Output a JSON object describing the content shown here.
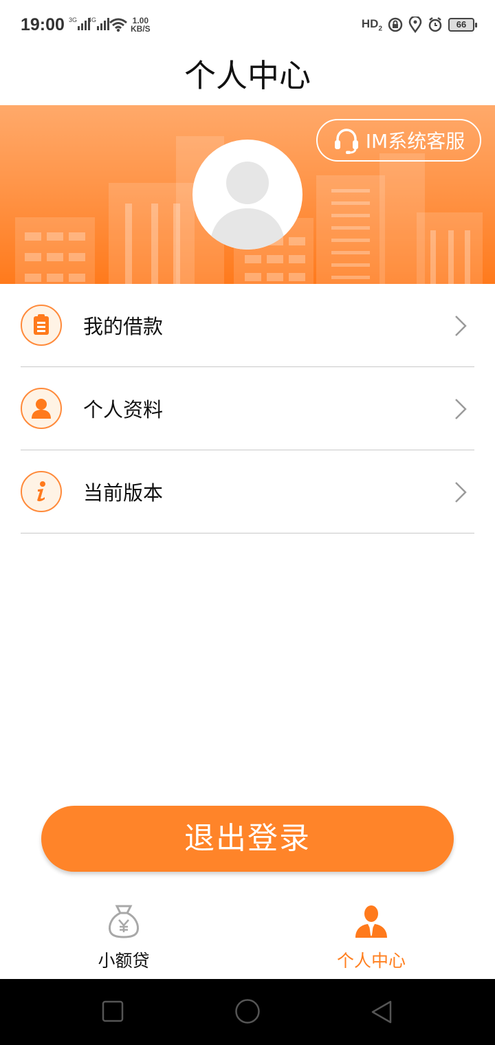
{
  "status_bar": {
    "time": "19:00",
    "net1": "3G",
    "net2": "4G",
    "speed_value": "1.00",
    "speed_unit": "KB/S",
    "hd": "HD",
    "hd_sub": "2",
    "battery": "66"
  },
  "header": {
    "title": "个人中心"
  },
  "banner": {
    "im_button_label": "IM系统客服",
    "colors": {
      "top": "#ffa96a",
      "bottom": "#ff7a1c"
    }
  },
  "menu": {
    "items": [
      {
        "label": "我的借款",
        "icon": "clipboard-icon"
      },
      {
        "label": "个人资料",
        "icon": "user-icon"
      },
      {
        "label": "当前版本",
        "icon": "info-icon"
      }
    ]
  },
  "logout": {
    "label": "退出登录",
    "color": "#ff8429"
  },
  "tabbar": {
    "tabs": [
      {
        "label": "小额贷",
        "icon": "money-bag-icon",
        "active": false
      },
      {
        "label": "个人中心",
        "icon": "person-icon",
        "active": true
      }
    ],
    "active_color": "#ff7f1f"
  },
  "system_nav": {
    "buttons": [
      "recent-apps-icon",
      "home-icon",
      "back-icon"
    ]
  }
}
